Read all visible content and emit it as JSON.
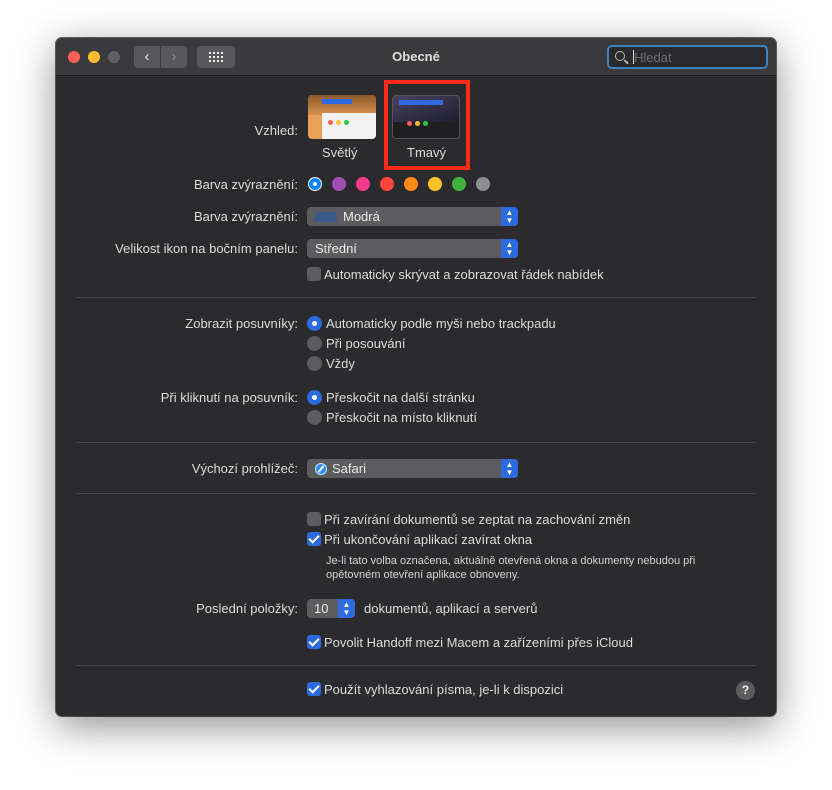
{
  "window": {
    "title": "Obecné"
  },
  "toolbar": {
    "back_icon": "‹",
    "forward_icon": "›"
  },
  "search": {
    "placeholder": "Hledat",
    "value": ""
  },
  "appearance": {
    "label": "Vzhled:",
    "options": [
      {
        "name": "Světlý",
        "selected": false
      },
      {
        "name": "Tmavý",
        "selected": true
      }
    ]
  },
  "accent": {
    "label": "Barva zvýraznění:",
    "colors": [
      "#0a84ff",
      "#9f4fb0",
      "#f23c8c",
      "#ff453a",
      "#ff8c1a",
      "#ffc02a",
      "#43b13c",
      "#8e8e90"
    ],
    "selected_index": 0
  },
  "highlight": {
    "label": "Barva zvýraznění:",
    "value": "Modrá",
    "swatch_color": "#3c5a8a"
  },
  "sidebar_icon_size": {
    "label": "Velikost ikon na bočním panelu:",
    "value": "Střední"
  },
  "menubar": {
    "label": "Automaticky skrývat a zobrazovat řádek nabídek",
    "checked": false
  },
  "scrollbars": {
    "label": "Zobrazit posuvníky:",
    "options": [
      "Automaticky podle myši nebo trackpadu",
      "Při posouvání",
      "Vždy"
    ],
    "selected_index": 0
  },
  "scroll_click": {
    "label": "Při kliknutí na posuvník:",
    "options": [
      "Přeskočit na další stránku",
      "Přeskočit na místo kliknutí"
    ],
    "selected_index": 0
  },
  "browser": {
    "label": "Výchozí prohlížeč:",
    "value": "Safari"
  },
  "close_docs": {
    "label": "Při zavírání dokumentů se zeptat na zachování změn",
    "checked": false
  },
  "close_windows": {
    "label": "Při ukončování aplikací zavírat okna",
    "checked": true,
    "note_line1": "Je-li tato volba označena, aktuálně otevřená okna a dokumenty nebudou při",
    "note_line2": "opětovném otevření aplikace obnoveny."
  },
  "recent": {
    "label": "Poslední položky:",
    "value": "10",
    "suffix": "dokumentů, aplikací a serverů"
  },
  "handoff": {
    "label": "Povolit Handoff mezi Macem a zařízeními přes iCloud",
    "checked": true
  },
  "font_smoothing": {
    "label": "Použít vyhlazování písma, je-li k dispozici",
    "checked": true
  },
  "help": {
    "label": "?"
  }
}
